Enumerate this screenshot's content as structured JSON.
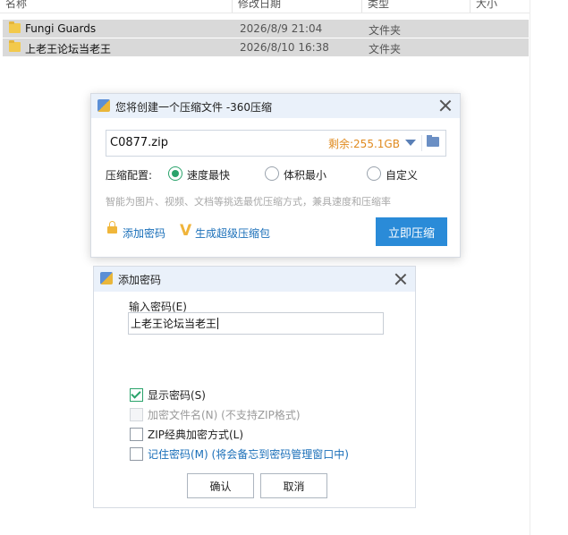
{
  "explorer": {
    "columns": {
      "name": "名称",
      "modified": "修改日期",
      "type": "类型",
      "size": "大小"
    },
    "rows": [
      {
        "name": "Fungi Guards",
        "date": "2026/8/9 21:04",
        "type": "文件夹"
      },
      {
        "name": "上老王论坛当老王",
        "date": "2026/8/10 16:38",
        "type": "文件夹"
      }
    ]
  },
  "compress_dialog": {
    "title": "您将创建一个压缩文件 -360压缩",
    "filename": "C0877.zip",
    "free_space": "剩余:255.1GB",
    "config_label": "压缩配置:",
    "options": [
      {
        "label": "速度最快",
        "selected": true
      },
      {
        "label": "体积最小",
        "selected": false
      },
      {
        "label": "自定义",
        "selected": false
      }
    ],
    "hint": "智能为图片、视频、文档等挑选最优压缩方式，兼具速度和压缩率",
    "add_password_link": "添加密码",
    "super_package_link": "生成超级压缩包",
    "compress_button": "立即压缩"
  },
  "password_dialog": {
    "title": "添加密码",
    "input_label": "输入密码(E)",
    "password_value": "上老王论坛当老王",
    "checkboxes": [
      {
        "label": "显示密码(S)",
        "checked": true,
        "disabled": false
      },
      {
        "label": "加密文件名(N) (不支持ZIP格式)",
        "checked": false,
        "disabled": true
      },
      {
        "label": "ZIP经典加密方式(L)",
        "checked": false,
        "disabled": false
      },
      {
        "label": "记住密码(M) (将会备忘到密码管理窗口中)",
        "checked": false,
        "disabled": false
      }
    ],
    "ok_button": "确认",
    "cancel_button": "取消"
  },
  "colors": {
    "accent_blue": "#2a8bd8",
    "radio_green": "#2aa36b",
    "free_space_orange": "#e08a1e",
    "link_blue": "#1a6fb9"
  }
}
